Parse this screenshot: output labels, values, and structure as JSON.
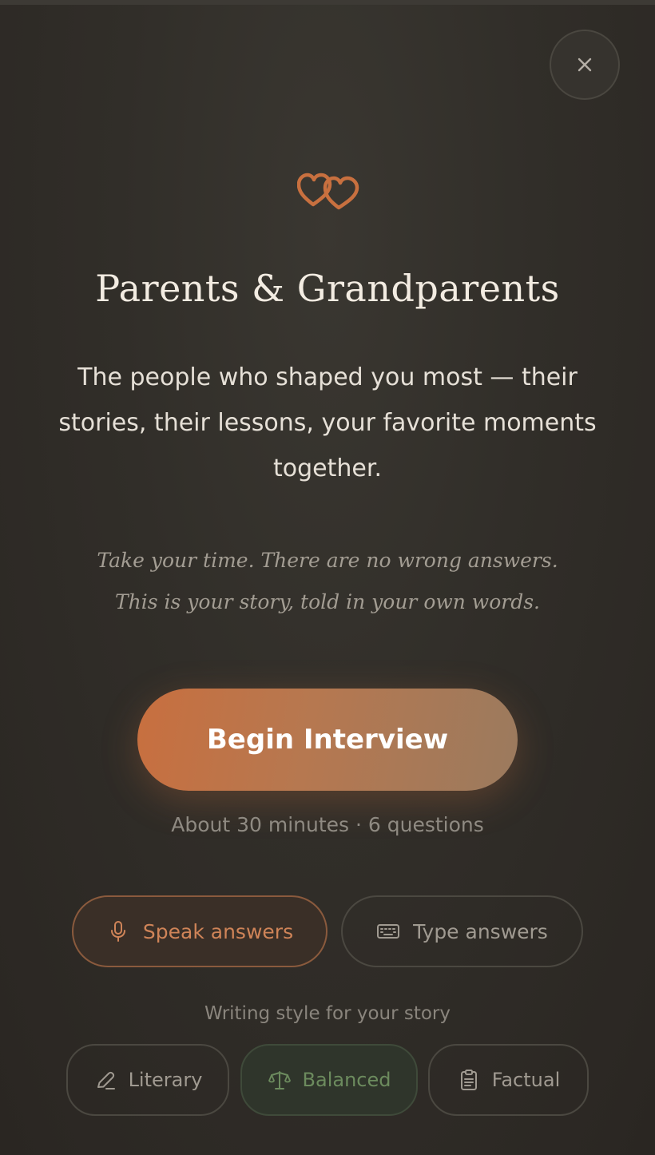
{
  "close": {
    "icon": "close-icon"
  },
  "header": {
    "icon": "hearts-icon",
    "title": "Parents & Grandparents",
    "subtitle": "The people who shaped you most — their stories, their lessons, your favorite moments together."
  },
  "quote": {
    "line1": "Take your time. There are no wrong answers.",
    "line2": "This is your story, told in your own words."
  },
  "primary_action": {
    "label": "Begin Interview"
  },
  "meta": {
    "text": "About 30 minutes · 6 questions"
  },
  "answer_modes": [
    {
      "label": "Speak answers",
      "icon": "microphone-icon",
      "selected": true
    },
    {
      "label": "Type answers",
      "icon": "keyboard-icon",
      "selected": false
    }
  ],
  "writing_style": {
    "label": "Writing style for your story",
    "options": [
      {
        "label": "Literary",
        "icon": "pen-icon",
        "selected": false
      },
      {
        "label": "Balanced",
        "icon": "balance-icon",
        "selected": true
      },
      {
        "label": "Factual",
        "icon": "clipboard-icon",
        "selected": false
      }
    ]
  },
  "colors": {
    "background": "#312e29",
    "accent": "#c86f3f",
    "selected_style": "#6c8b5e"
  }
}
